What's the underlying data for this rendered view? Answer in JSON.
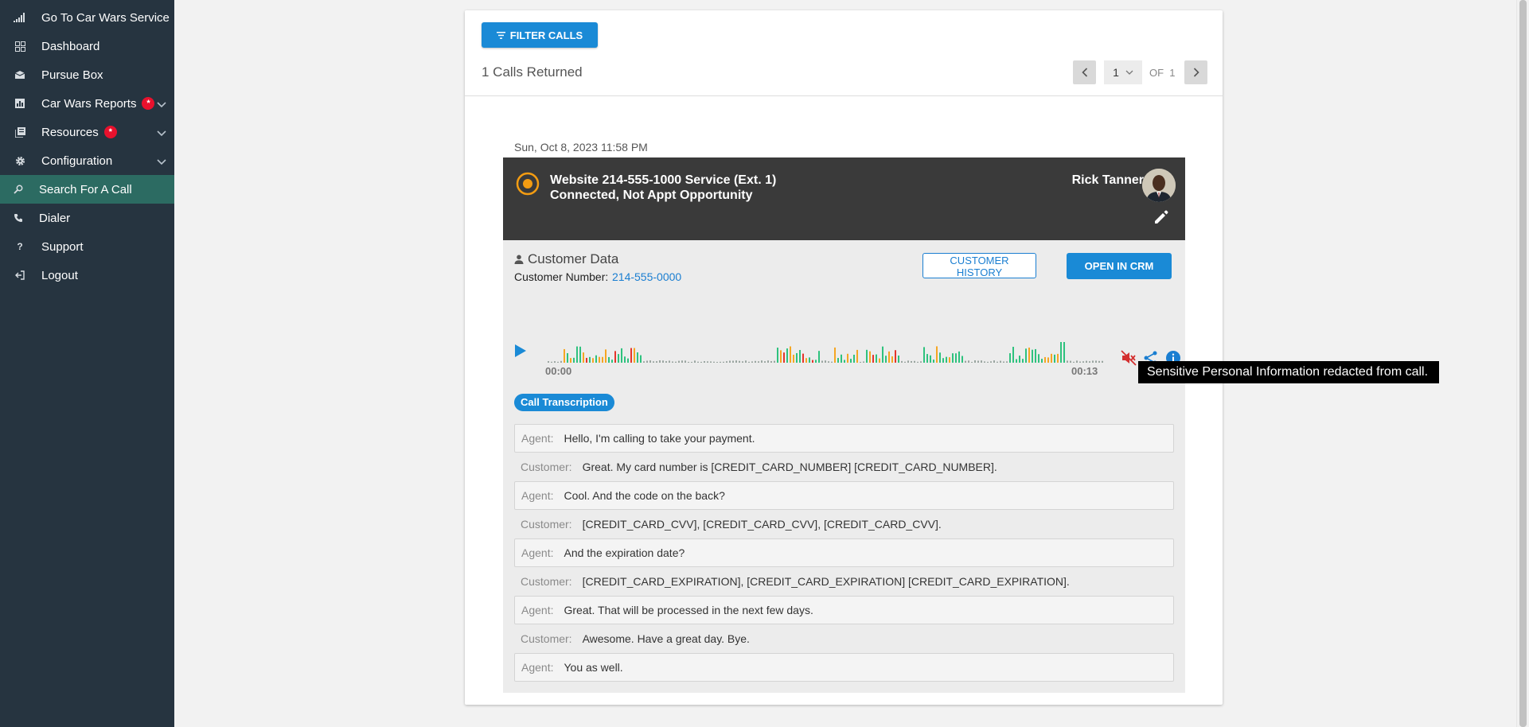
{
  "sidebar": {
    "items": [
      {
        "label": "Go To Car Wars Service",
        "icon": "signal-bars-icon"
      },
      {
        "label": "Dashboard",
        "icon": "dashboard-icon"
      },
      {
        "label": "Pursue Box",
        "icon": "inbox-icon"
      },
      {
        "label": "Car Wars Reports",
        "icon": "report-icon",
        "badge": "*"
      },
      {
        "label": "Resources",
        "icon": "library-icon",
        "badge": "*"
      },
      {
        "label": "Configuration",
        "icon": "gear-icon"
      },
      {
        "label": "Search For A Call",
        "icon": "search-icon"
      },
      {
        "label": "Dialer",
        "icon": "phone-icon"
      },
      {
        "label": "Support",
        "icon": "question-icon"
      },
      {
        "label": "Logout",
        "icon": "logout-icon"
      }
    ]
  },
  "toolbar": {
    "filter_label": "FILTER CALLS",
    "calls_returned": "1 Calls Returned",
    "page_current": "1",
    "page_of": "OF  1"
  },
  "call": {
    "date": "Sun, Oct 8, 2023 11:58 PM",
    "source": "Website 214-555-1000 Service (Ext. 1)",
    "status": "Connected, Not Appt Opportunity",
    "agent": "Rick Tanner",
    "customer_title": "Customer Data",
    "customer_number_label": "Customer Number:",
    "customer_number": "214-555-0000",
    "history_label": "CUSTOMER HISTORY",
    "crm_label": "OPEN IN CRM",
    "time_start": "00:00",
    "time_end": "00:13",
    "transcription_label": "Call Transcription",
    "tooltip": "Sensitive Personal Information redacted from call."
  },
  "transcript": [
    {
      "speaker": "Agent:",
      "text": "Hello, I'm calling to take your payment."
    },
    {
      "speaker": "Customer:",
      "text": "Great. My card number is [CREDIT_CARD_NUMBER] [CREDIT_CARD_NUMBER]."
    },
    {
      "speaker": "Agent:",
      "text": "Cool. And the code on the back?"
    },
    {
      "speaker": "Customer:",
      "text": "[CREDIT_CARD_CVV], [CREDIT_CARD_CVV], [CREDIT_CARD_CVV]."
    },
    {
      "speaker": "Agent:",
      "text": "And the expiration date?"
    },
    {
      "speaker": "Customer:",
      "text": "[CREDIT_CARD_EXPIRATION], [CREDIT_CARD_EXPIRATION] [CREDIT_CARD_EXPIRATION]."
    },
    {
      "speaker": "Agent:",
      "text": "Great. That will be processed in the next few days."
    },
    {
      "speaker": "Customer:",
      "text": "Awesome. Have a great day. Bye."
    },
    {
      "speaker": "Agent:",
      "text": "You as well."
    }
  ],
  "colors": {
    "sidebar_bg": "#263440",
    "active_item": "#2c6b62",
    "accent": "#1a8ad6",
    "badge": "#e8112d",
    "wave_green": "#2ec27e",
    "wave_orange": "#f5a623",
    "wave_red": "#e5352b"
  }
}
